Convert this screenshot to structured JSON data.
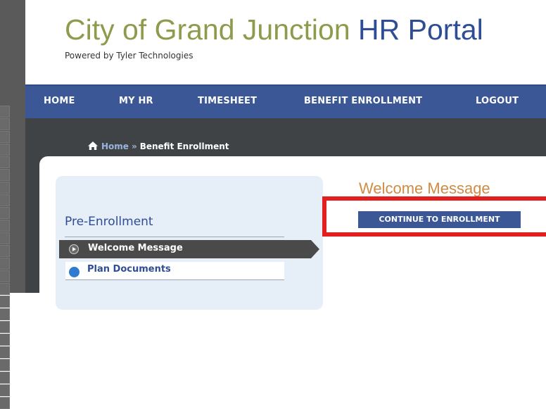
{
  "header": {
    "title_part1": "City of Grand Junction",
    "title_part2": "HR Portal",
    "powered_by": "Powered by Tyler Technologies"
  },
  "nav": {
    "items": [
      {
        "label": "HOME"
      },
      {
        "label": "MY HR"
      },
      {
        "label": "TIMESHEET"
      },
      {
        "label": "BENEFIT ENROLLMENT"
      },
      {
        "label": "LOGOUT"
      }
    ]
  },
  "breadcrumb": {
    "icon": "home-icon",
    "home": "Home",
    "separator": "»",
    "current": "Benefit Enrollment"
  },
  "sidebar": {
    "section_title": "Pre-Enrollment",
    "items": [
      {
        "label": "Welcome Message",
        "active": true,
        "icon": "play-circle-icon"
      },
      {
        "label": "Plan Documents",
        "active": false,
        "icon": "circle-bullet-icon"
      }
    ]
  },
  "main": {
    "title": "Welcome Message",
    "continue_button": "CONTINUE TO ENROLLMENT"
  },
  "colors": {
    "title_green": "#8f9a4c",
    "title_blue": "#2f4d94",
    "nav_bg": "#3b5796",
    "welcome_orange": "#d08b45",
    "highlight_red": "#e31e1e"
  }
}
